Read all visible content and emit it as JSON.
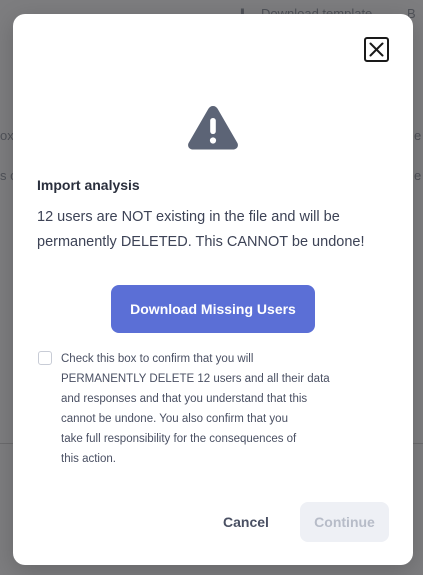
{
  "background": {
    "download_template_link": "Download template",
    "download_template_suffix": "B",
    "left_fragment_1": "ox",
    "left_fragment_2": "s c",
    "right_fragment_1": "e",
    "right_fragment_2": "e"
  },
  "modal": {
    "close_icon": "close-icon",
    "warning_icon": "warning-triangle-icon",
    "title": "Import analysis",
    "message_line1": "12 users are NOT existing in the file and will be",
    "message_line2": "permanently DELETED. This CANNOT be undone!",
    "download_button": "Download Missing Users",
    "confirm_lines": [
      "Check this box to confirm that you will",
      "PERMANENTLY DELETE 12 users and all their data",
      "and responses and that you understand that this",
      "cannot be undone. You also confirm that you",
      "take full responsibility for the consequences of",
      "this action."
    ],
    "confirm_checked": false,
    "cancel_button": "Cancel",
    "continue_button": "Continue",
    "continue_disabled": true
  },
  "colors": {
    "accent": "#5b6fd6",
    "warning_icon": "#5c6476",
    "overlay": "#7d7d7f"
  }
}
